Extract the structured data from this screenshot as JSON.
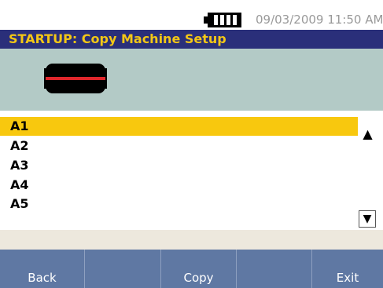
{
  "status": {
    "battery_icon": "battery-full-icon",
    "datetime": "09/03/2009 11:50 AM"
  },
  "title": "STARTUP: Copy Machine Setup",
  "device": {
    "icon": "copy-machine-icon",
    "accent_color": "#e0262b"
  },
  "list": {
    "items": [
      "A1",
      "A2",
      "A3",
      "A4",
      "A5"
    ],
    "selected": "A1",
    "scroll_up_glyph": "▲",
    "scroll_down_glyph": "▼"
  },
  "softkeys": [
    {
      "label": "Back"
    },
    {
      "label": ""
    },
    {
      "label": "Copy"
    },
    {
      "label": ""
    },
    {
      "label": "Exit"
    }
  ],
  "colors": {
    "title_bg": "#2a2f7a",
    "title_fg": "#f3c716",
    "device_bg": "#b3cac6",
    "selection": "#f8c80e",
    "softkey_bg": "#5f78a3"
  }
}
